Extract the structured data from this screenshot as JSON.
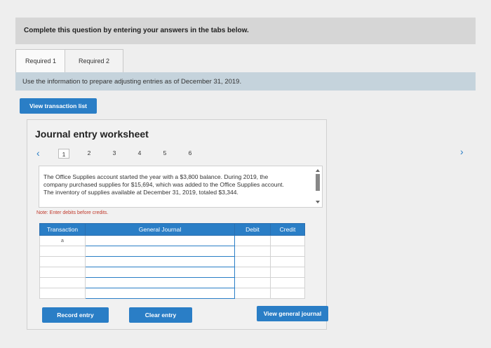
{
  "header": {
    "instruction": "Complete this question by entering your answers in the tabs below."
  },
  "tabs": [
    {
      "label": "Required 1"
    },
    {
      "label": "Required 2"
    }
  ],
  "info": {
    "text": "Use the information to prepare adjusting entries as of December 31, 2019."
  },
  "buttons": {
    "view_transaction_list": "View transaction list",
    "record_entry": "Record entry",
    "clear_entry": "Clear entry",
    "view_general_journal": "View general journal"
  },
  "worksheet": {
    "title": "Journal entry worksheet",
    "pages": [
      "1",
      "2",
      "3",
      "4",
      "5",
      "6"
    ],
    "active_page": "1",
    "question": "The Office Supplies account started the year with a $3,800 balance. During 2019, the company purchased supplies for $15,694, which was added to the Office Supplies account. The inventory of supplies available at December 31, 2019, totaled $3,344.",
    "note": "Note: Enter debits before credits."
  },
  "table": {
    "headers": {
      "transaction": "Transaction",
      "account": "General Journal",
      "debit": "Debit",
      "credit": "Credit"
    },
    "first_transaction": "a"
  },
  "colors": {
    "accent": "#2a7ec6",
    "info_bar": "#c5d3dc",
    "top_bar": "#d6d6d6",
    "note": "#c0392b"
  }
}
